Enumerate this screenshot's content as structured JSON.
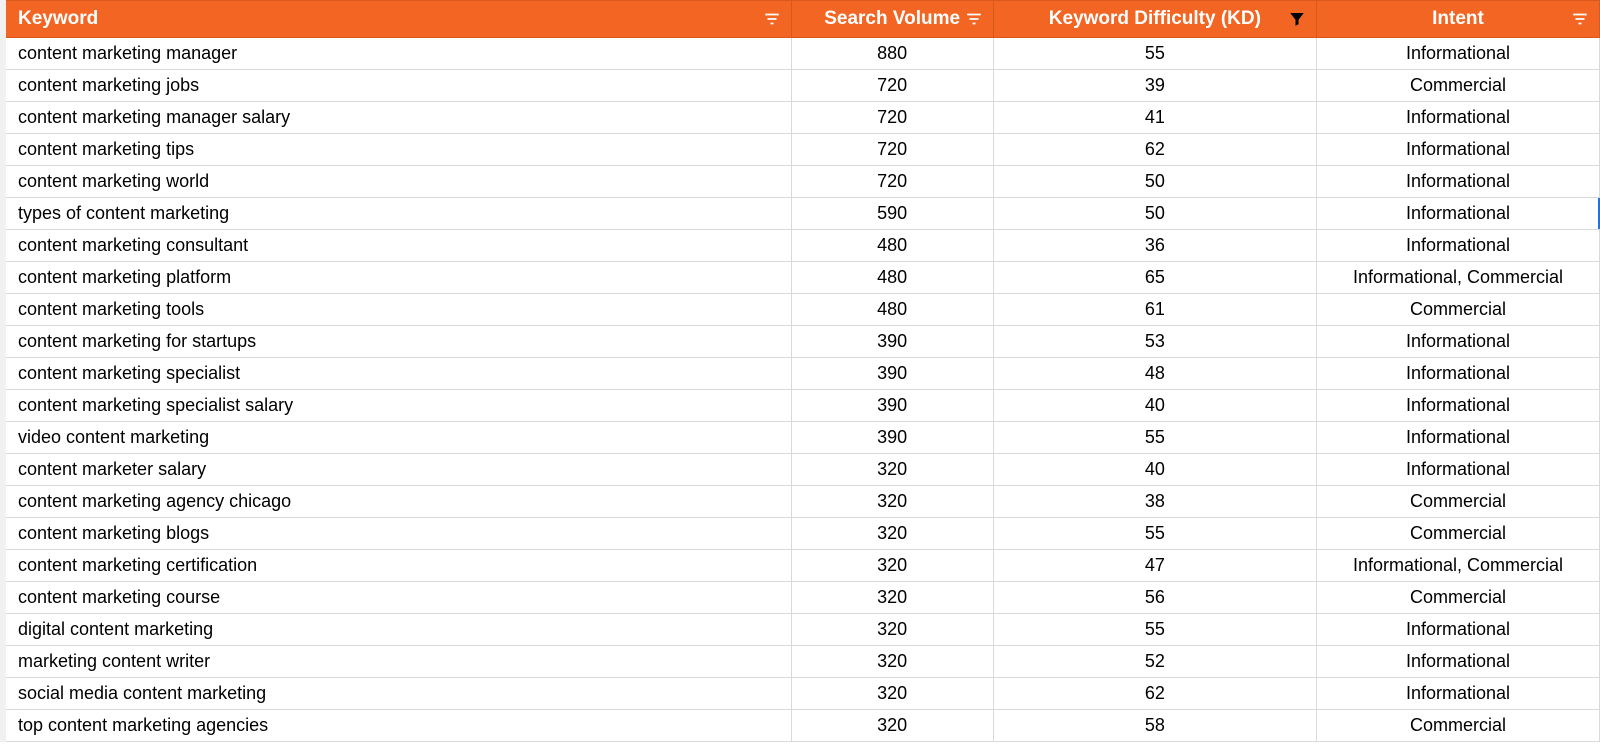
{
  "columns": {
    "keyword": "Keyword",
    "search_volume": "Search Volume",
    "kd": "Keyword Difficulty (KD)",
    "intent": "Intent"
  },
  "rows": [
    {
      "keyword": "content marketing manager",
      "sv": "880",
      "kd": "55",
      "intent": "Informational"
    },
    {
      "keyword": "content marketing jobs",
      "sv": "720",
      "kd": "39",
      "intent": "Commercial"
    },
    {
      "keyword": "content marketing manager salary",
      "sv": "720",
      "kd": "41",
      "intent": "Informational"
    },
    {
      "keyword": "content marketing tips",
      "sv": "720",
      "kd": "62",
      "intent": "Informational"
    },
    {
      "keyword": "content marketing world",
      "sv": "720",
      "kd": "50",
      "intent": "Informational"
    },
    {
      "keyword": "types of content marketing",
      "sv": "590",
      "kd": "50",
      "intent": "Informational"
    },
    {
      "keyword": "content marketing consultant",
      "sv": "480",
      "kd": "36",
      "intent": "Informational"
    },
    {
      "keyword": "content marketing platform",
      "sv": "480",
      "kd": "65",
      "intent": "Informational, Commercial"
    },
    {
      "keyword": "content marketing tools",
      "sv": "480",
      "kd": "61",
      "intent": "Commercial"
    },
    {
      "keyword": "content marketing for startups",
      "sv": "390",
      "kd": "53",
      "intent": "Informational"
    },
    {
      "keyword": "content marketing specialist",
      "sv": "390",
      "kd": "48",
      "intent": "Informational"
    },
    {
      "keyword": "content marketing specialist salary",
      "sv": "390",
      "kd": "40",
      "intent": "Informational"
    },
    {
      "keyword": "video content marketing",
      "sv": "390",
      "kd": "55",
      "intent": "Informational"
    },
    {
      "keyword": "content marketer salary",
      "sv": "320",
      "kd": "40",
      "intent": "Informational"
    },
    {
      "keyword": "content marketing agency chicago",
      "sv": "320",
      "kd": "38",
      "intent": "Commercial"
    },
    {
      "keyword": "content marketing blogs",
      "sv": "320",
      "kd": "55",
      "intent": "Commercial"
    },
    {
      "keyword": "content marketing certification",
      "sv": "320",
      "kd": "47",
      "intent": "Informational, Commercial"
    },
    {
      "keyword": "content marketing course",
      "sv": "320",
      "kd": "56",
      "intent": "Commercial"
    },
    {
      "keyword": "digital content marketing",
      "sv": "320",
      "kd": "55",
      "intent": "Informational"
    },
    {
      "keyword": "marketing content writer",
      "sv": "320",
      "kd": "52",
      "intent": "Informational"
    },
    {
      "keyword": "social media content marketing",
      "sv": "320",
      "kd": "62",
      "intent": "Informational"
    },
    {
      "keyword": "top content marketing agencies",
      "sv": "320",
      "kd": "58",
      "intent": "Commercial"
    }
  ],
  "selected_edge_row": 5
}
